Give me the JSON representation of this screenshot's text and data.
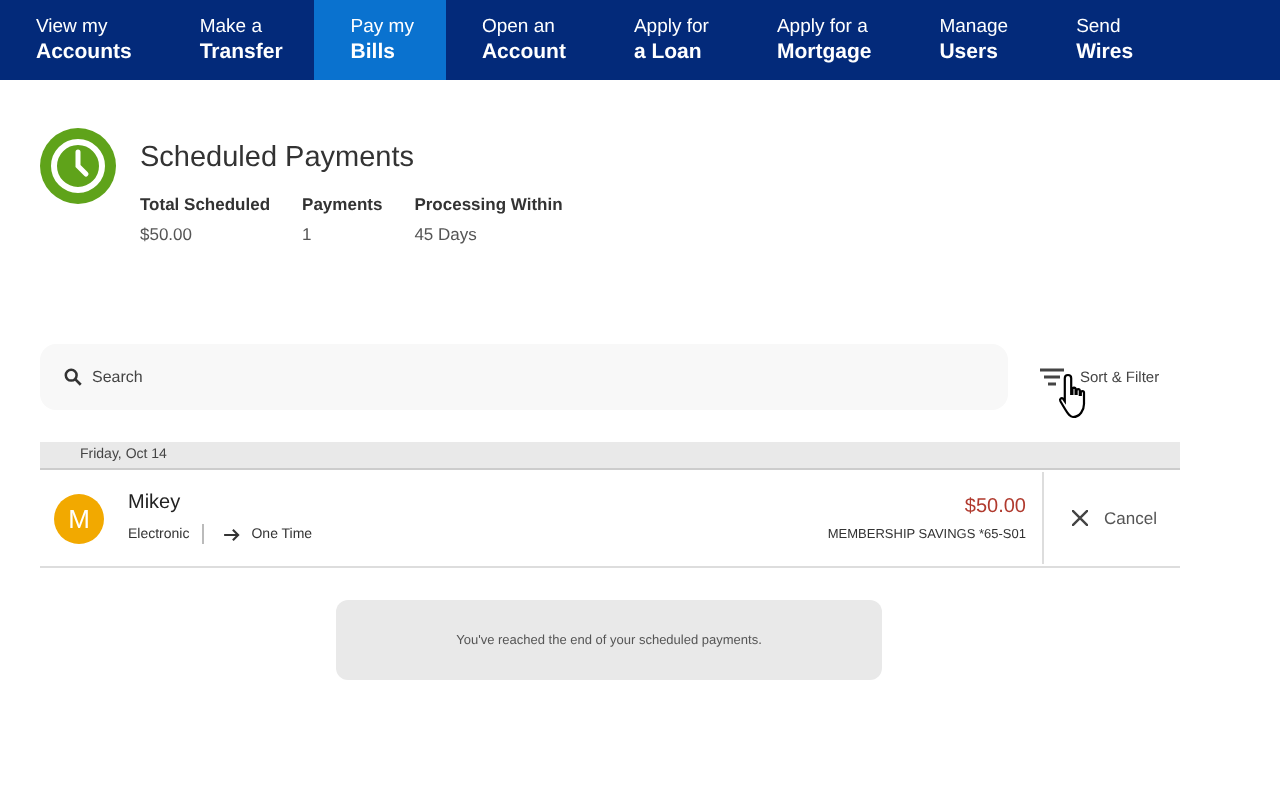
{
  "nav": [
    {
      "line1": "View my",
      "line2": "Accounts",
      "selected": false
    },
    {
      "line1": "Make a",
      "line2": "Transfer",
      "selected": false
    },
    {
      "line1": "Pay my",
      "line2": "Bills",
      "selected": true
    },
    {
      "line1": "Open an",
      "line2": "Account",
      "selected": false
    },
    {
      "line1": "Apply for",
      "line2": "a Loan",
      "selected": false
    },
    {
      "line1": "Apply for a",
      "line2": "Mortgage",
      "selected": false
    },
    {
      "line1": "Manage",
      "line2": "Users",
      "selected": false
    },
    {
      "line1": "Send",
      "line2": "Wires",
      "selected": false
    }
  ],
  "header": {
    "title": "Scheduled Payments",
    "stats": [
      {
        "label": "Total Scheduled",
        "value": "$50.00"
      },
      {
        "label": "Payments",
        "value": "1"
      },
      {
        "label": "Processing Within",
        "value": "45 Days"
      }
    ]
  },
  "search": {
    "placeholder": "Search"
  },
  "sort_filter": "Sort & Filter",
  "groups": [
    {
      "date": "Friday, Oct 14",
      "payments": [
        {
          "initial": "M",
          "color": "#f2a900",
          "payee": "Mikey",
          "method": "Electronic",
          "frequency": "One Time",
          "amount": "$50.00",
          "account": "MEMBERSHIP SAVINGS *65-S01",
          "action": "Cancel"
        }
      ]
    }
  ],
  "end_message": "You've reached the end of your scheduled payments."
}
